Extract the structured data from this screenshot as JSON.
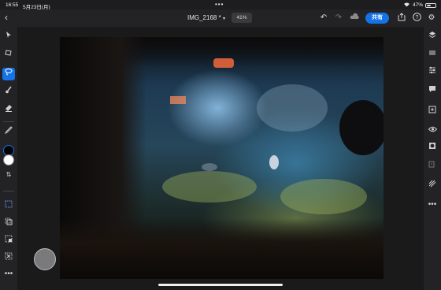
{
  "status": {
    "time": "16:55",
    "date": "5月23日(月)",
    "wifi_icon": "wifi-icon",
    "battery_text": "47%",
    "battery_level": 0.47
  },
  "toolbar": {
    "back_icon": "chevron-left-icon",
    "title": "IMG_2168 *",
    "title_chevron": "chevron-down-icon",
    "zoom": "41%",
    "undo_icon": "undo-icon",
    "redo_icon": "redo-icon",
    "cloud_icon": "cloud-icon",
    "share_label": "共有",
    "share_color": "#1473e6",
    "export_icon": "export-icon",
    "help_icon": "help-icon",
    "settings_icon": "gear-icon"
  },
  "left_tools": [
    {
      "name": "move-tool",
      "icon": "arrow-icon",
      "active": false
    },
    {
      "name": "transform-tool",
      "icon": "transform-icon",
      "active": false
    },
    {
      "name": "lasso-tool",
      "icon": "lasso-icon",
      "active": true
    },
    {
      "name": "brush-tool",
      "icon": "brush-icon",
      "active": false
    },
    {
      "name": "eraser-tool",
      "icon": "eraser-icon",
      "active": false
    },
    {
      "name": "eyedropper-tool",
      "icon": "eyedropper-icon",
      "active": false
    }
  ],
  "colors": {
    "foreground": "#000000",
    "background": "#ffffff"
  },
  "right_tools": [
    {
      "name": "layers",
      "icon": "layers-icon"
    },
    {
      "name": "layer-properties",
      "icon": "layer-properties-icon"
    },
    {
      "name": "adjustments",
      "icon": "sliders-icon"
    },
    {
      "name": "comments",
      "icon": "comment-icon"
    },
    {
      "name": "add-layer",
      "icon": "add-layer-icon"
    },
    {
      "name": "visibility",
      "icon": "eye-icon"
    },
    {
      "name": "mask",
      "icon": "mask-icon"
    },
    {
      "name": "layer-style",
      "icon": "layer-style-icon"
    },
    {
      "name": "brush-settings",
      "icon": "brush-settings-icon"
    },
    {
      "name": "more",
      "icon": "more-icon"
    }
  ],
  "document": {
    "image": "underwater cave photo"
  }
}
